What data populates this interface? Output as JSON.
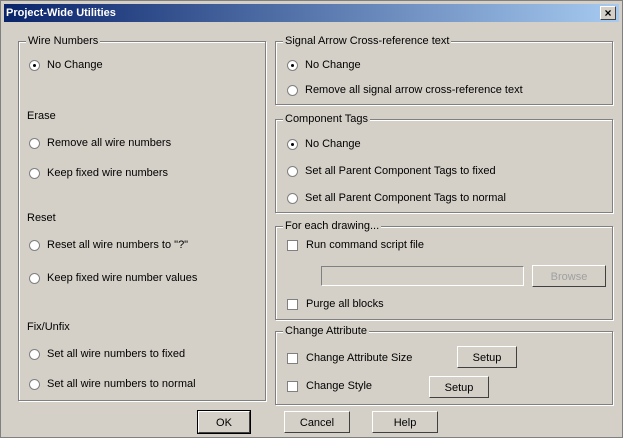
{
  "window": {
    "title": "Project-Wide Utilities",
    "close_label": "×"
  },
  "wire_numbers": {
    "label": "Wire Numbers",
    "no_change": "No Change",
    "erase_label": "Erase",
    "erase_remove": "Remove all wire numbers",
    "erase_keep": "Keep fixed wire numbers",
    "reset_label": "Reset",
    "reset_all": "Reset all wire numbers to \"?\"",
    "reset_keep": "Keep fixed wire number values",
    "fix_label": "Fix/Unfix",
    "fix_fixed": "Set all wire numbers to fixed",
    "fix_normal": "Set all wire numbers to normal"
  },
  "signal_arrow": {
    "label": "Signal Arrow Cross-reference text",
    "no_change": "No Change",
    "remove": "Remove all signal arrow cross-reference text"
  },
  "component_tags": {
    "label": "Component Tags",
    "no_change": "No Change",
    "fixed": "Set all Parent Component Tags to fixed",
    "normal": "Set all Parent Component Tags to normal"
  },
  "each_drawing": {
    "label": "For each drawing...",
    "run_script": "Run command script file",
    "script_value": "",
    "browse": "Browse",
    "purge": "Purge all blocks"
  },
  "change_attribute": {
    "label": "Change Attribute",
    "size": "Change Attribute Size",
    "setup1": "Setup",
    "style": "Change Style",
    "setup2": "Setup"
  },
  "buttons": {
    "ok": "OK",
    "cancel": "Cancel",
    "help": "Help"
  }
}
